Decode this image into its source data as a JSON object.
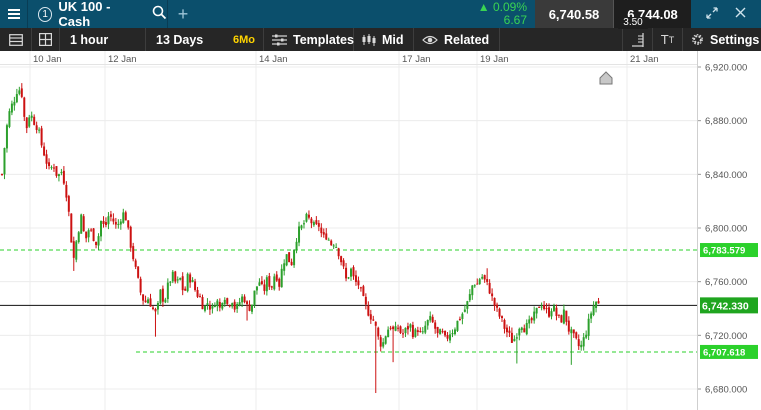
{
  "header": {
    "instrument_number": "1",
    "instrument_name": "UK 100 - Cash",
    "change_percent": "0.09%",
    "change_points": "6.67",
    "sell_price": "6,740.58",
    "buy_price": "6,744.08",
    "spread": "3.50"
  },
  "toolbar": {
    "interval": "1 hour",
    "range": "13 Days",
    "range_badge": "6Mo",
    "templates_label": "Templates",
    "price_type": "Mid",
    "related_label": "Related",
    "settings_label": "Settings"
  },
  "colors": {
    "header_bg": "#0b4f6c",
    "toolbar_bg": "#262626",
    "up_candle": "#2ca02c",
    "down_candle": "#cc1111",
    "current_price_tag": "#1fa51f",
    "dashed_line": "#2bd12b"
  },
  "chart_data": {
    "type": "candlestick",
    "x_tick_labels": [
      "10 Jan",
      "12 Jan",
      "14 Jan",
      "17 Jan",
      "19 Jan",
      "21 Jan"
    ],
    "y_tick_labels": [
      "6,920.000",
      "6,880.000",
      "6,840.000",
      "6,800.000",
      "6,760.000",
      "6,720.000",
      "6,680.000"
    ],
    "y_ticks": [
      6920,
      6880,
      6840,
      6800,
      6760,
      6720,
      6680
    ],
    "ylim": [
      6673,
      6925
    ],
    "grid": true,
    "current_price": 6742.33,
    "current_price_label": "6,742.330",
    "levels": [
      {
        "value": 6783.579,
        "label": "6,783.579"
      },
      {
        "value": 6707.618,
        "label": "6,707.618"
      }
    ],
    "close_path": [
      [
        0,
        6840
      ],
      [
        4,
        6872
      ],
      [
        8,
        6888
      ],
      [
        12,
        6895
      ],
      [
        16,
        6905
      ],
      [
        20,
        6900
      ],
      [
        24,
        6872
      ],
      [
        28,
        6886
      ],
      [
        32,
        6880
      ],
      [
        36,
        6875
      ],
      [
        40,
        6862
      ],
      [
        44,
        6852
      ],
      [
        48,
        6842
      ],
      [
        52,
        6848
      ],
      [
        56,
        6838
      ],
      [
        60,
        6842
      ],
      [
        64,
        6832
      ],
      [
        68,
        6808
      ],
      [
        72,
        6775
      ],
      [
        76,
        6795
      ],
      [
        80,
        6808
      ],
      [
        84,
        6790
      ],
      [
        88,
        6800
      ],
      [
        92,
        6794
      ],
      [
        96,
        6788
      ],
      [
        100,
        6805
      ],
      [
        104,
        6800
      ],
      [
        108,
        6810
      ],
      [
        112,
        6806
      ],
      [
        116,
        6800
      ],
      [
        120,
        6808
      ],
      [
        124,
        6812
      ],
      [
        128,
        6795
      ],
      [
        132,
        6780
      ],
      [
        136,
        6765
      ],
      [
        140,
        6752
      ],
      [
        144,
        6744
      ],
      [
        148,
        6748
      ],
      [
        152,
        6740
      ],
      [
        156,
        6735
      ],
      [
        160,
        6752
      ],
      [
        164,
        6745
      ],
      [
        168,
        6758
      ],
      [
        172,
        6765
      ],
      [
        176,
        6758
      ],
      [
        180,
        6762
      ],
      [
        184,
        6750
      ],
      [
        188,
        6765
      ],
      [
        192,
        6760
      ],
      [
        196,
        6752
      ],
      [
        200,
        6748
      ],
      [
        204,
        6740
      ],
      [
        208,
        6745
      ],
      [
        212,
        6738
      ],
      [
        216,
        6748
      ],
      [
        220,
        6740
      ],
      [
        224,
        6752
      ],
      [
        228,
        6742
      ],
      [
        232,
        6748
      ],
      [
        236,
        6738
      ],
      [
        240,
        6745
      ],
      [
        244,
        6750
      ],
      [
        248,
        6740
      ],
      [
        252,
        6742
      ],
      [
        256,
        6755
      ],
      [
        260,
        6760
      ],
      [
        264,
        6752
      ],
      [
        268,
        6762
      ],
      [
        272,
        6755
      ],
      [
        276,
        6768
      ],
      [
        280,
        6758
      ],
      [
        284,
        6775
      ],
      [
        288,
        6780
      ],
      [
        292,
        6772
      ],
      [
        296,
        6790
      ],
      [
        300,
        6798
      ],
      [
        304,
        6802
      ],
      [
        308,
        6808
      ],
      [
        312,
        6805
      ],
      [
        316,
        6800
      ],
      [
        320,
        6802
      ],
      [
        324,
        6792
      ],
      [
        328,
        6795
      ],
      [
        332,
        6788
      ],
      [
        336,
        6790
      ],
      [
        340,
        6782
      ],
      [
        344,
        6772
      ],
      [
        348,
        6760
      ],
      [
        352,
        6770
      ],
      [
        356,
        6760
      ],
      [
        360,
        6758
      ],
      [
        364,
        6748
      ],
      [
        368,
        6740
      ],
      [
        372,
        6735
      ],
      [
        376,
        6730
      ],
      [
        380,
        6718
      ],
      [
        384,
        6712
      ],
      [
        388,
        6722
      ],
      [
        392,
        6728
      ],
      [
        396,
        6722
      ],
      [
        400,
        6726
      ],
      [
        404,
        6720
      ],
      [
        408,
        6724
      ],
      [
        412,
        6728
      ],
      [
        416,
        6720
      ],
      [
        420,
        6725
      ],
      [
        424,
        6718
      ],
      [
        428,
        6728
      ],
      [
        432,
        6732
      ],
      [
        436,
        6728
      ],
      [
        440,
        6720
      ],
      [
        444,
        6722
      ],
      [
        448,
        6716
      ],
      [
        452,
        6722
      ],
      [
        456,
        6724
      ],
      [
        460,
        6730
      ],
      [
        464,
        6735
      ],
      [
        468,
        6740
      ],
      [
        472,
        6748
      ],
      [
        476,
        6760
      ],
      [
        480,
        6758
      ],
      [
        484,
        6765
      ],
      [
        488,
        6760
      ],
      [
        492,
        6755
      ],
      [
        496,
        6745
      ],
      [
        500,
        6738
      ],
      [
        504,
        6732
      ],
      [
        508,
        6725
      ],
      [
        512,
        6720
      ],
      [
        516,
        6715
      ],
      [
        520,
        6722
      ],
      [
        524,
        6730
      ],
      [
        528,
        6725
      ],
      [
        532,
        6728
      ],
      [
        536,
        6732
      ],
      [
        540,
        6738
      ],
      [
        544,
        6745
      ],
      [
        548,
        6740
      ],
      [
        552,
        6736
      ],
      [
        556,
        6742
      ],
      [
        560,
        6735
      ],
      [
        564,
        6730
      ],
      [
        568,
        6738
      ],
      [
        572,
        6725
      ],
      [
        576,
        6720
      ],
      [
        580,
        6715
      ],
      [
        584,
        6710
      ],
      [
        588,
        6718
      ],
      [
        592,
        6728
      ],
      [
        596,
        6740
      ],
      [
        600,
        6745
      ],
      [
        604,
        6742
      ]
    ]
  }
}
